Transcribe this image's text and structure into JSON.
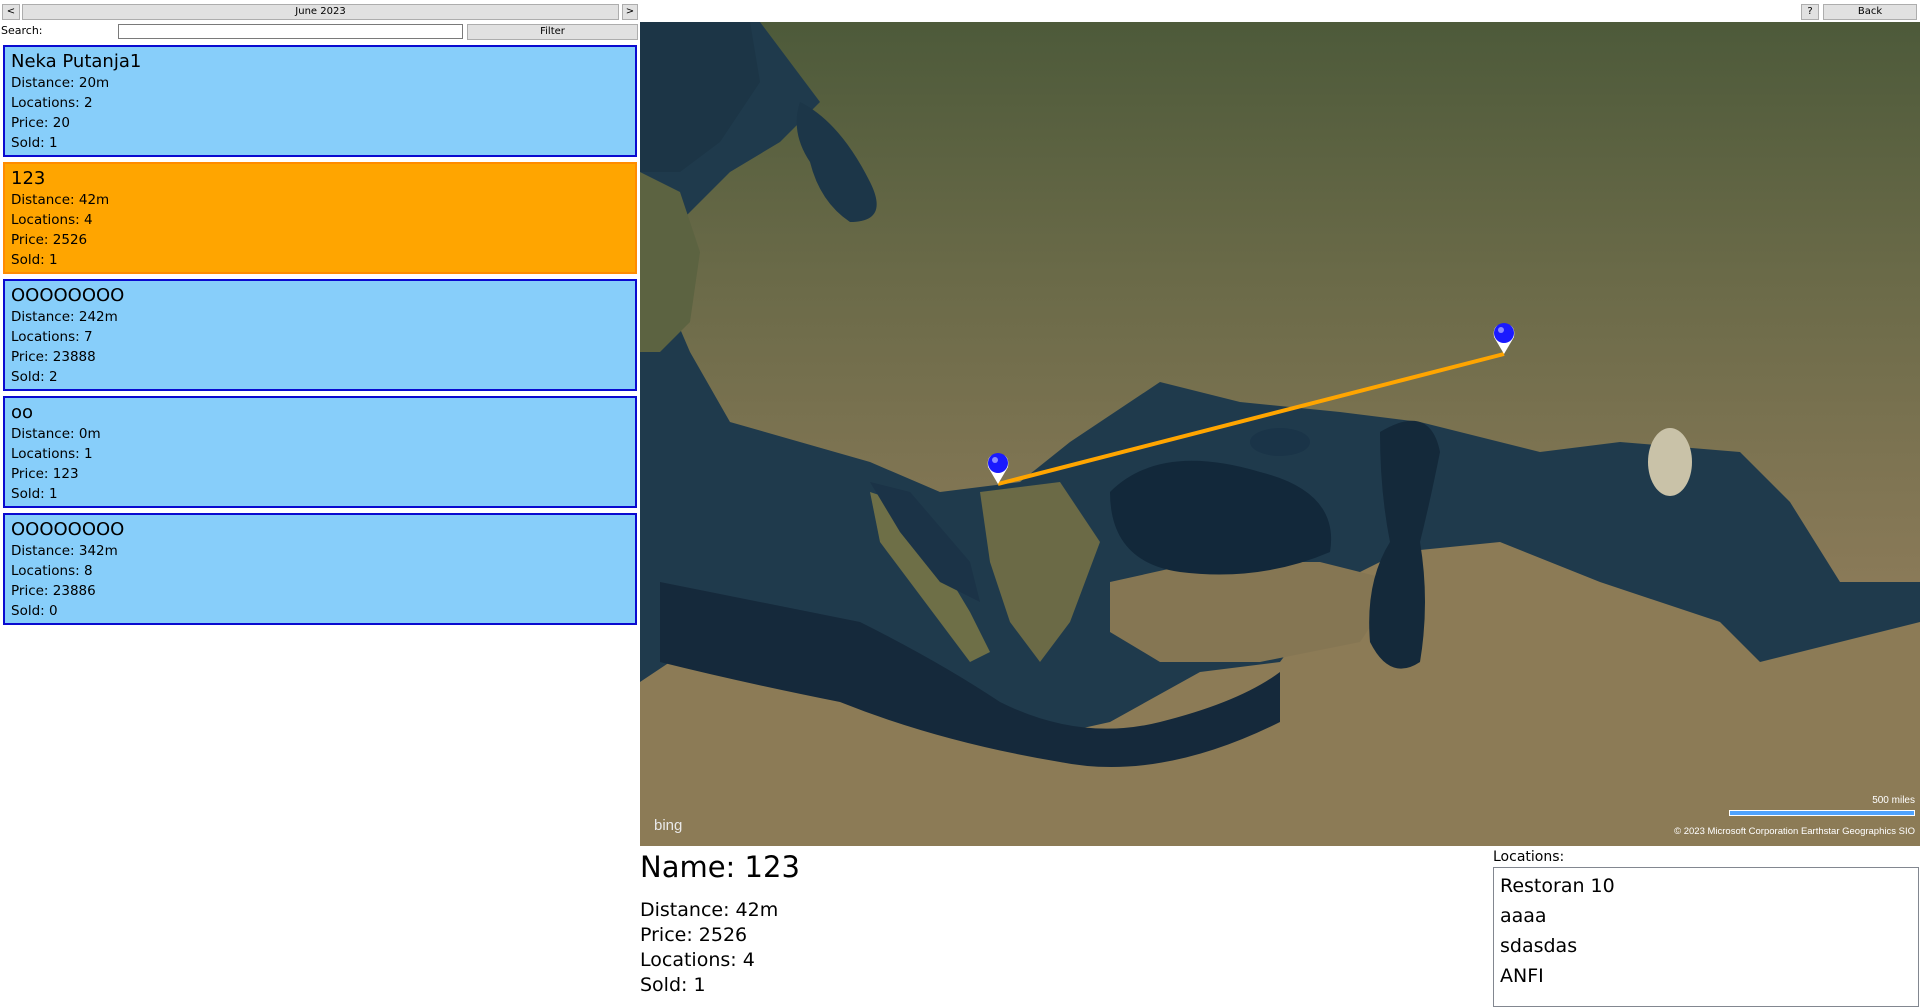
{
  "nav": {
    "prev_label": "<",
    "month_label": "June 2023",
    "next_label": ">",
    "help_label": "?",
    "back_label": "Back"
  },
  "search": {
    "label": "Search:",
    "value": "",
    "filter_label": "Filter"
  },
  "routes": [
    {
      "name": "Neka Putanja1",
      "distance": "Distance: 20m",
      "locations": "Locations: 2",
      "price": "Price: 20",
      "sold": "Sold: 1",
      "selected": false
    },
    {
      "name": "123",
      "distance": "Distance: 42m",
      "locations": "Locations: 4",
      "price": "Price: 2526",
      "sold": "Sold: 1",
      "selected": true
    },
    {
      "name": "OOOOOOOO",
      "distance": "Distance: 242m",
      "locations": "Locations: 7",
      "price": "Price: 23888",
      "sold": "Sold: 2",
      "selected": false
    },
    {
      "name": "oo",
      "distance": "Distance: 0m",
      "locations": "Locations: 1",
      "price": "Price: 123",
      "sold": "Sold: 1",
      "selected": false
    },
    {
      "name": "OOOOOOOO",
      "distance": "Distance: 342m",
      "locations": "Locations: 8",
      "price": "Price: 23886",
      "sold": "Sold: 0",
      "selected": false
    }
  ],
  "map": {
    "logo": "bing",
    "scale_label": "500 miles",
    "copyright": "© 2023 Microsoft Corporation    Earthstar Geographics  SIO",
    "route_color": "#ffa500",
    "pin_color": "#1a1aff",
    "pin_icon": "map-pin-icon"
  },
  "detail": {
    "name": "Name: 123",
    "distance": "Distance: 42m",
    "price": "Price: 2526",
    "locations": "Locations: 4",
    "sold": "Sold: 1"
  },
  "locations_panel": {
    "label": "Locations:",
    "items": [
      "Restoran 10",
      "aaaa",
      "sdasdas",
      "ANFI"
    ]
  },
  "colors": {
    "card_bg": "#87cefa",
    "card_border": "#0a0ad0",
    "selected_bg": "#ffa500"
  }
}
